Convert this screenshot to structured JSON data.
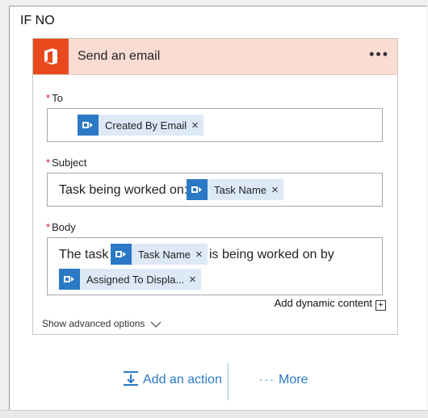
{
  "branch": {
    "title": "IF NO"
  },
  "card": {
    "title": "Send an email",
    "menu_icon": "ellipsis-icon",
    "brand_color": "#e8491d",
    "header_color": "#fadcd2"
  },
  "fields": {
    "to": {
      "required_mark": "*",
      "label": "To",
      "tokens": [
        "Created By Email"
      ]
    },
    "subject": {
      "required_mark": "*",
      "label": "Subject",
      "prefix_text": "Task being worked on:",
      "tokens": [
        "Task Name"
      ]
    },
    "body": {
      "required_mark": "*",
      "label": "Body",
      "text_before": "The task",
      "token_1": "Task Name",
      "text_after": "is being worked on by",
      "token_2": "Assigned To Displa..."
    }
  },
  "token_close": "×",
  "dynamic_content": {
    "label": "Add dynamic content",
    "icon": "+"
  },
  "advanced": {
    "label": "Show advanced options"
  },
  "actions": {
    "add_action": "Add an action",
    "more_dots": "···",
    "more": "More",
    "accent": "#2b78c5"
  }
}
